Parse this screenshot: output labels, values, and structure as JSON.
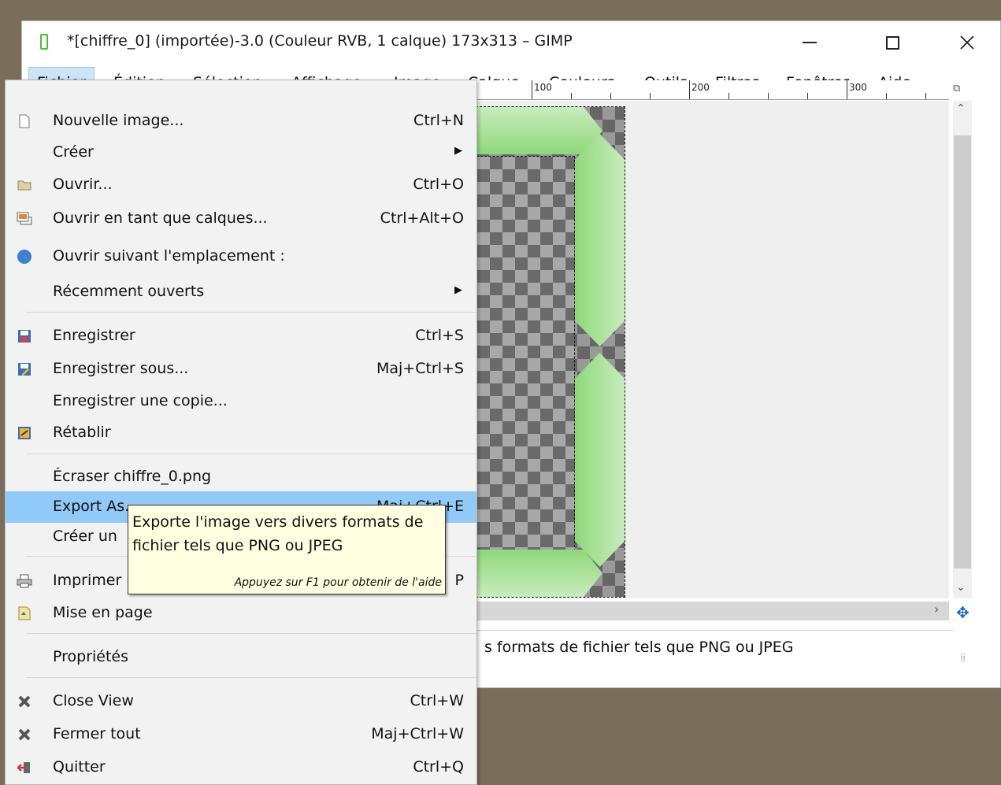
{
  "window": {
    "title": "*[chiffre_0] (importée)-3.0 (Couleur RVB, 1 calque) 173x313 – GIMP"
  },
  "menubar": {
    "items": [
      {
        "label": "Fichier",
        "active": true
      },
      {
        "label": "Édition"
      },
      {
        "label": "Sélection"
      },
      {
        "label": "Affichage"
      },
      {
        "label": "Image"
      },
      {
        "label": "Calque"
      },
      {
        "label": "Couleurs"
      },
      {
        "label": "Outils"
      },
      {
        "label": "Filtres"
      },
      {
        "label": "Fenêtres"
      },
      {
        "label": "Aide"
      }
    ]
  },
  "ruler": {
    "labels": [
      "100",
      "200",
      "300"
    ]
  },
  "status": {
    "text": "s formats de fichier tels que PNG ou JPEG"
  },
  "file_menu": {
    "items": [
      {
        "label": "Nouvelle image...",
        "shortcut": "Ctrl+N",
        "icon": "new-image-icon"
      },
      {
        "label": "Créer",
        "submenu": true
      },
      {
        "label": "Ouvrir...",
        "shortcut": "Ctrl+O",
        "icon": "open-folder-icon"
      },
      {
        "label": "Ouvrir en tant que calques...",
        "shortcut": "Ctrl+Alt+O",
        "icon": "open-as-layers-icon"
      },
      {
        "label": "Ouvrir suivant l'emplacement :",
        "icon": "globe-icon"
      },
      {
        "label": "Récemment ouverts",
        "submenu": true
      },
      {
        "label": "Enregistrer",
        "shortcut": "Ctrl+S",
        "icon": "save-icon"
      },
      {
        "label": "Enregistrer sous...",
        "shortcut": "Maj+Ctrl+S",
        "icon": "save-as-icon"
      },
      {
        "label": "Enregistrer une copie..."
      },
      {
        "label": "Rétablir",
        "icon": "revert-icon"
      },
      {
        "label": "Écraser chiffre_0.png"
      },
      {
        "label": "Export As...",
        "shortcut": "Maj+Ctrl+E",
        "highlighted": true
      },
      {
        "label": "Créer un"
      },
      {
        "label": "Imprimer",
        "shortcut": "P",
        "icon": "printer-icon"
      },
      {
        "label": "Mise en page",
        "icon": "page-setup-icon"
      },
      {
        "label": "Propriétés"
      },
      {
        "label": "Close View",
        "shortcut": "Ctrl+W",
        "icon": "close-view-icon"
      },
      {
        "label": "Fermer tout",
        "shortcut": "Maj+Ctrl+W",
        "icon": "close-all-icon"
      },
      {
        "label": "Quitter",
        "shortcut": "Ctrl+Q",
        "icon": "quit-icon"
      }
    ]
  },
  "tooltip": {
    "text": "Exporte l'image vers divers formats de fichier tels que PNG ou JPEG",
    "hint": "Appuyez sur F1 pour obtenir de l'aide"
  }
}
